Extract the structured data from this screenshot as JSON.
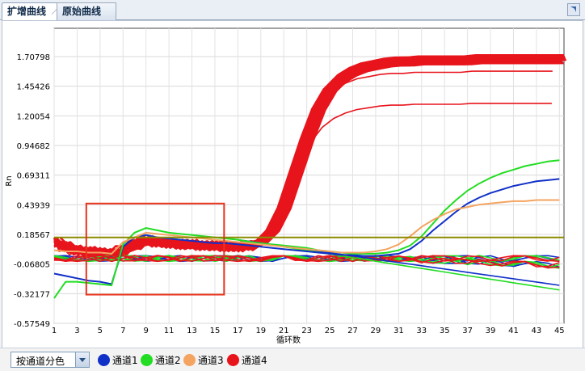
{
  "tabs": [
    {
      "label": "扩增曲线",
      "active": true
    },
    {
      "label": "原始曲线",
      "active": false
    }
  ],
  "chart_data": {
    "type": "line",
    "ylabel": "Rn",
    "xlabel": "循环数",
    "x_ticks": [
      1,
      3,
      5,
      7,
      9,
      11,
      13,
      15,
      17,
      19,
      21,
      23,
      25,
      27,
      29,
      31,
      33,
      35,
      37,
      39,
      41,
      43,
      45
    ],
    "y_ticks": [
      "1.70798",
      "1.45426",
      "1.20054",
      "0.94682",
      "0.69311",
      "0.43939",
      "0.18567",
      "-0.06805",
      "-0.32177",
      "-0.57549"
    ],
    "xlim": [
      1,
      45.4
    ],
    "ylim": [
      -0.57549,
      1.95
    ],
    "threshold": 0.16,
    "threshold_color": "#8a8a00",
    "series_colors": {
      "通道1": "#1030c8",
      "通道2": "#22dd22",
      "通道3": "#f4a460",
      "通道4": "#e8141c"
    },
    "series": [
      {
        "name": "通道1",
        "values": [
          -0.15,
          -0.17,
          -0.19,
          -0.21,
          -0.22,
          -0.24,
          0.08,
          0.16,
          0.18,
          0.16,
          0.15,
          0.14,
          0.13,
          0.12,
          0.11,
          0.11,
          0.1,
          0.09,
          0.08,
          0.07,
          0.06,
          0.05,
          0.04,
          0.03,
          0.02,
          0.01,
          0.01,
          0.0,
          0.0,
          0.01,
          0.02,
          0.06,
          0.13,
          0.22,
          0.3,
          0.38,
          0.45,
          0.5,
          0.54,
          0.57,
          0.6,
          0.62,
          0.64,
          0.65,
          0.66
        ]
      },
      {
        "name": "通道2",
        "values": [
          -0.36,
          -0.22,
          -0.22,
          -0.23,
          -0.24,
          -0.25,
          0.1,
          0.2,
          0.24,
          0.22,
          0.2,
          0.19,
          0.18,
          0.17,
          0.16,
          0.15,
          0.14,
          0.12,
          0.11,
          0.1,
          0.09,
          0.08,
          0.07,
          0.05,
          0.04,
          0.03,
          0.02,
          0.02,
          0.02,
          0.03,
          0.05,
          0.09,
          0.17,
          0.28,
          0.39,
          0.48,
          0.56,
          0.62,
          0.67,
          0.71,
          0.74,
          0.77,
          0.79,
          0.81,
          0.82
        ]
      },
      {
        "name": "通道3",
        "values": [
          0.05,
          0.04,
          0.04,
          0.03,
          0.03,
          0.02,
          0.12,
          0.16,
          0.2,
          0.19,
          0.18,
          0.17,
          0.16,
          0.15,
          0.14,
          0.13,
          0.12,
          0.11,
          0.1,
          0.09,
          0.08,
          0.07,
          0.06,
          0.05,
          0.04,
          0.03,
          0.03,
          0.03,
          0.04,
          0.06,
          0.1,
          0.17,
          0.25,
          0.31,
          0.36,
          0.4,
          0.42,
          0.44,
          0.45,
          0.46,
          0.47,
          0.47,
          0.48,
          0.48,
          0.48
        ]
      },
      {
        "name": "通道4",
        "values": [
          0.12,
          0.08,
          0.05,
          0.04,
          0.03,
          0.02,
          0.05,
          0.1,
          0.13,
          0.12,
          0.11,
          0.1,
          0.1,
          0.09,
          0.09,
          0.08,
          0.08,
          0.09,
          0.12,
          0.22,
          0.42,
          0.72,
          1.02,
          1.28,
          1.45,
          1.55,
          1.61,
          1.65,
          1.67,
          1.69,
          1.7,
          1.7,
          1.71,
          1.71,
          1.71,
          1.71,
          1.71,
          1.72,
          1.72,
          1.72,
          1.72,
          1.72,
          1.72,
          1.72,
          1.72
        ]
      }
    ],
    "selection_box": {
      "x_range": [
        3.8,
        15.8
      ],
      "y_range": [
        -0.33,
        0.45
      ]
    }
  },
  "footer": {
    "color_mode": "按通道分色",
    "legend": [
      {
        "label": "通道1",
        "color": "#1030c8"
      },
      {
        "label": "通道2",
        "color": "#22dd22"
      },
      {
        "label": "通道3",
        "color": "#f4a460"
      },
      {
        "label": "通道4",
        "color": "#e8141c"
      }
    ]
  }
}
